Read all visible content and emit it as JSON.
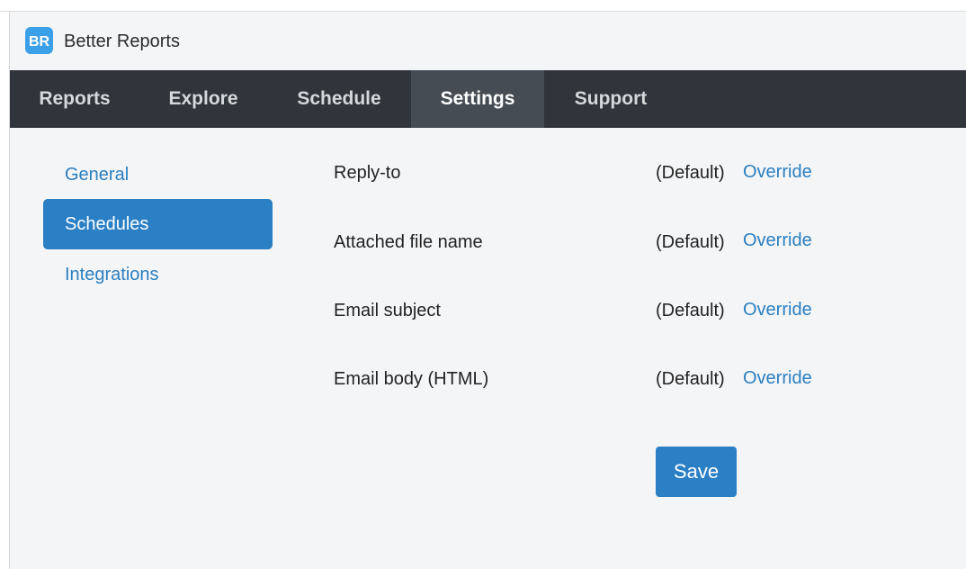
{
  "app": {
    "title": "Better Reports",
    "logo_icon": "better-reports-logo-icon",
    "brand_color": "#3aa0e8"
  },
  "nav": {
    "items": [
      {
        "label": "Reports",
        "active": false
      },
      {
        "label": "Explore",
        "active": false
      },
      {
        "label": "Schedule",
        "active": false
      },
      {
        "label": "Settings",
        "active": true
      },
      {
        "label": "Support",
        "active": false
      }
    ]
  },
  "sidebar": {
    "items": [
      {
        "label": "General",
        "active": false
      },
      {
        "label": "Schedules",
        "active": true
      },
      {
        "label": "Integrations",
        "active": false
      }
    ]
  },
  "settings": {
    "rows": [
      {
        "label": "Reply-to",
        "default_text": "(Default)",
        "action": "Override"
      },
      {
        "label": "Attached file name",
        "default_text": "(Default)",
        "action": "Override"
      },
      {
        "label": "Email subject",
        "default_text": "(Default)",
        "action": "Override"
      },
      {
        "label": "Email body (HTML)",
        "default_text": "(Default)",
        "action": "Override"
      }
    ],
    "save_label": "Save"
  },
  "colors": {
    "nav_bg": "#30353c",
    "nav_active_bg": "#454c54",
    "accent": "#2b7fc5",
    "link": "#2a7fc1",
    "page_bg": "#f4f5f7"
  }
}
